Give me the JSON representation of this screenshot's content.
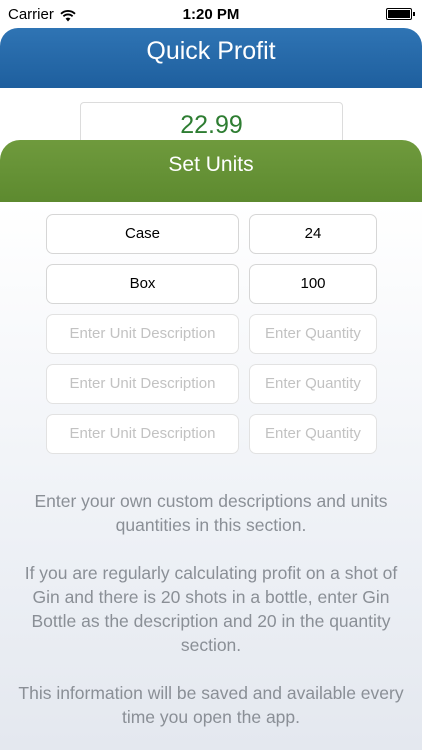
{
  "status_bar": {
    "carrier": "Carrier",
    "time": "1:20 PM"
  },
  "header": {
    "title": "Quick Profit",
    "color": "#2467a8"
  },
  "profit_value": "22.99",
  "set_units": {
    "title": "Set Units",
    "color": "#648f35",
    "rows": [
      {
        "description": "Case",
        "quantity": "24"
      },
      {
        "description": "Box",
        "quantity": "100"
      },
      {
        "description_placeholder": "Enter Unit Description",
        "quantity_placeholder": "Enter Quantity"
      },
      {
        "description_placeholder": "Enter Unit Description",
        "quantity_placeholder": "Enter Quantity"
      },
      {
        "description_placeholder": "Enter Unit Description",
        "quantity_placeholder": "Enter Quantity"
      }
    ]
  },
  "info_text": {
    "paragraph1": "Enter your own custom descriptions and units quantities in this section.",
    "paragraph2": "If you are regularly calculating profit on a shot of Gin and there is 20 shots in a bottle, enter Gin Bottle as the description and 20 in the quantity section.",
    "paragraph3": "This information will be saved and available every time you open the app."
  }
}
